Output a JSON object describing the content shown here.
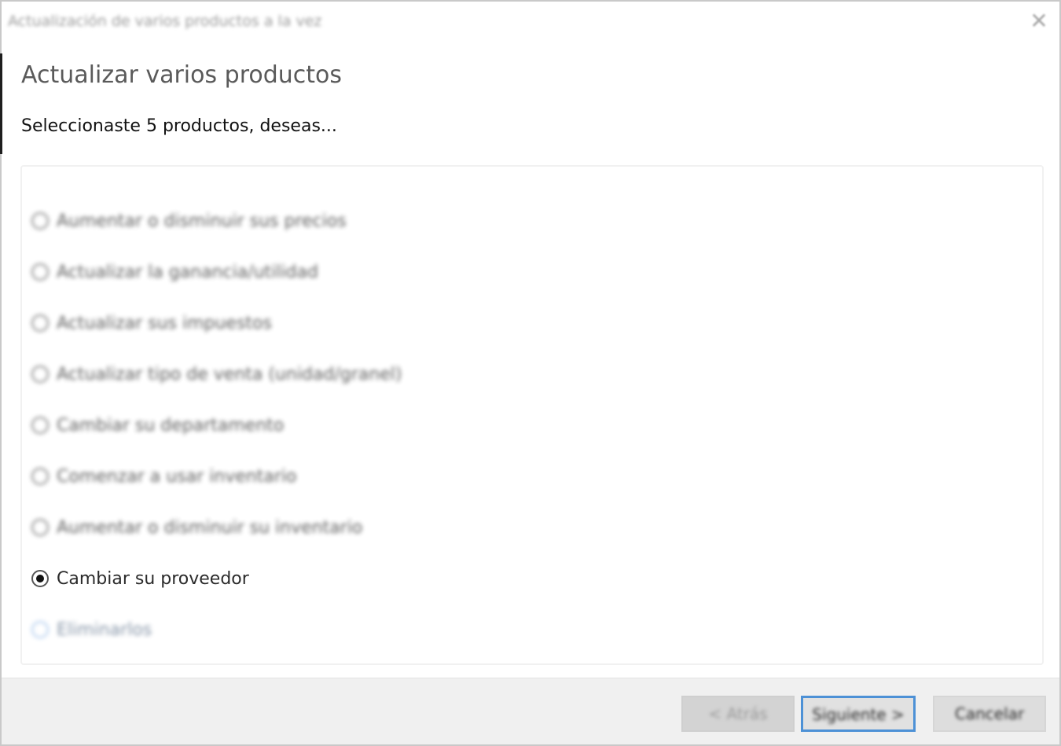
{
  "window": {
    "title": "Actualización de varios productos a la vez",
    "close_glyph": "✕"
  },
  "header": {
    "title": "Actualizar varios productos",
    "subtitle": "Seleccionaste 5 productos, deseas..."
  },
  "options": [
    {
      "label": "Aumentar o disminuir sus precios",
      "checked": false
    },
    {
      "label": "Actualizar la ganancia/utilidad",
      "checked": false
    },
    {
      "label": "Actualizar sus impuestos",
      "checked": false
    },
    {
      "label": "Actualizar tipo de venta (unidad/granel)",
      "checked": false
    },
    {
      "label": "Cambiar su departamento",
      "checked": false
    },
    {
      "label": "Comenzar a usar inventario",
      "checked": false
    },
    {
      "label": "Aumentar o disminuir su inventario",
      "checked": false
    },
    {
      "label": "Cambiar su proveedor",
      "checked": true
    },
    {
      "label": "Eliminarlos",
      "checked": false
    }
  ],
  "footer": {
    "back_label": "< Atrás",
    "next_label": "Siguiente >",
    "cancel_label": "Cancelar"
  },
  "colors": {
    "focus_border": "#4d91d6",
    "footer_bg": "#f0f0f0"
  }
}
